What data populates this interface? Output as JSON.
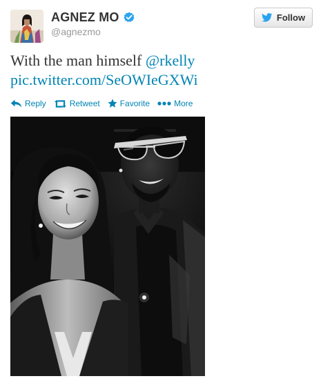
{
  "user": {
    "name": "AGNEZ MO",
    "screen_name": "@agnezmo",
    "verified": true,
    "verified_color": "#2aa3ef"
  },
  "follow_button": {
    "label": "Follow",
    "icon": "twitter-bird-icon",
    "icon_color": "#2aa3ef"
  },
  "tweet": {
    "text": "With the man himself ",
    "mention": "@rkelly",
    "link": "pic.twitter.com/SeOWIeGXWi",
    "link_color": "#0084b4"
  },
  "actions": [
    {
      "label": "Reply",
      "icon": "reply-icon"
    },
    {
      "label": "Retweet",
      "icon": "retweet-icon"
    },
    {
      "label": "Favorite",
      "icon": "star-icon"
    },
    {
      "label": "More",
      "icon": "more-dots-icon"
    }
  ],
  "media": {
    "type": "photo",
    "style": "black-and-white"
  }
}
